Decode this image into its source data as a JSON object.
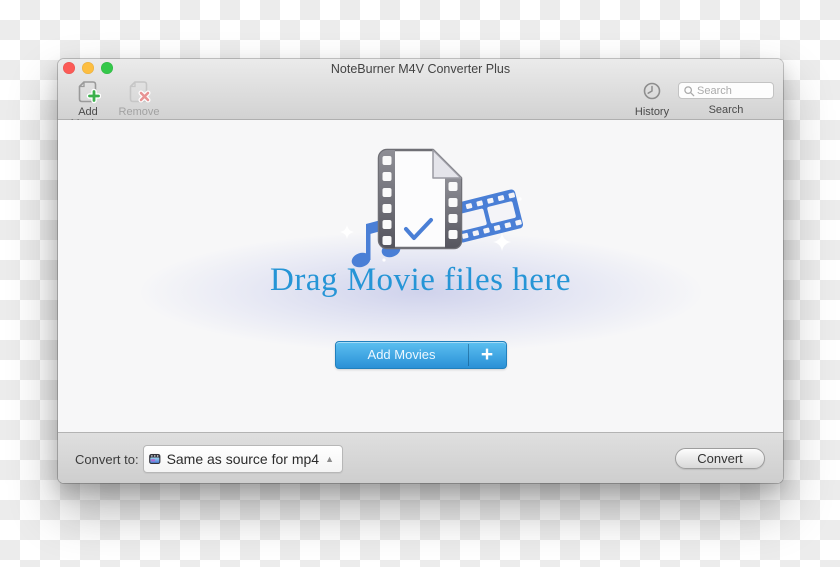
{
  "window": {
    "title": "NoteBurner M4V Converter Plus"
  },
  "toolbar": {
    "add_movies_label": "Add Movies",
    "remove_label": "Remove",
    "history_label": "History",
    "search_label": "Search",
    "search_placeholder": "Search"
  },
  "main": {
    "heading": "Drag Movie files here",
    "add_button_label": "Add Movies",
    "add_button_plus": "+"
  },
  "footer": {
    "convert_to_label": "Convert to:",
    "format_value": "Same as source for mp4",
    "dropdown_arrow": "▲",
    "convert_button_label": "Convert"
  },
  "icons": {
    "add_movies": "document-plus-icon",
    "remove": "document-x-icon",
    "history": "clock-icon",
    "search": "magnifier-icon",
    "format": "movie-clapper-icon",
    "dropzone": "movie-file-with-music-note-filmstrip-icon"
  },
  "colors": {
    "heading_text": "#2695d6",
    "accent_blue_top": "#5cc0f1",
    "accent_blue_bottom": "#2a90d6",
    "icon_blue": "#4a7fd6",
    "traffic_close": "#fc5b57",
    "traffic_minimize": "#fdbe41",
    "traffic_zoom": "#34c84a"
  }
}
